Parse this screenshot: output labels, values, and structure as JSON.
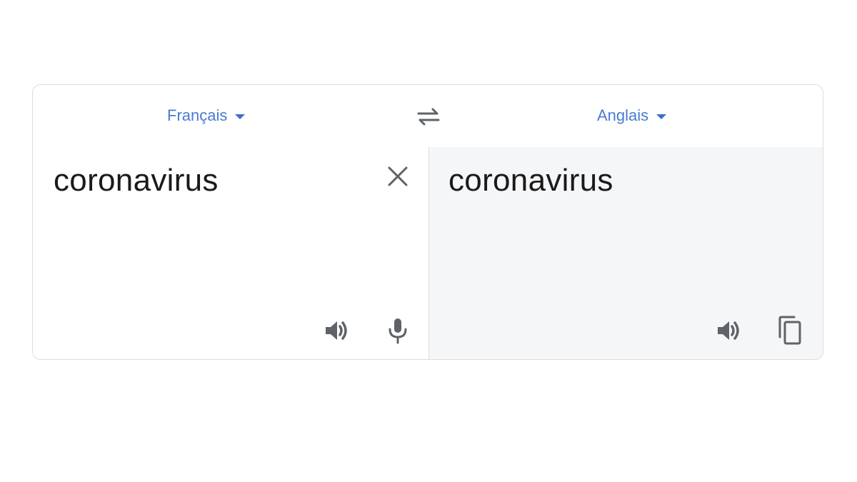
{
  "source_language": {
    "label": "Français"
  },
  "target_language": {
    "label": "Anglais"
  },
  "source_text": "coronavirus",
  "translated_text": "coronavirus",
  "icons": {
    "swap": "swap-languages-icon",
    "clear": "close-icon",
    "source_listen": "speaker-icon",
    "microphone": "microphone-icon",
    "target_listen": "speaker-icon",
    "copy": "copy-icon"
  },
  "colors": {
    "accent": "#4a7bd0",
    "icon": "#5f6368",
    "target_bg": "#f5f6f8",
    "border": "#dadce0"
  }
}
